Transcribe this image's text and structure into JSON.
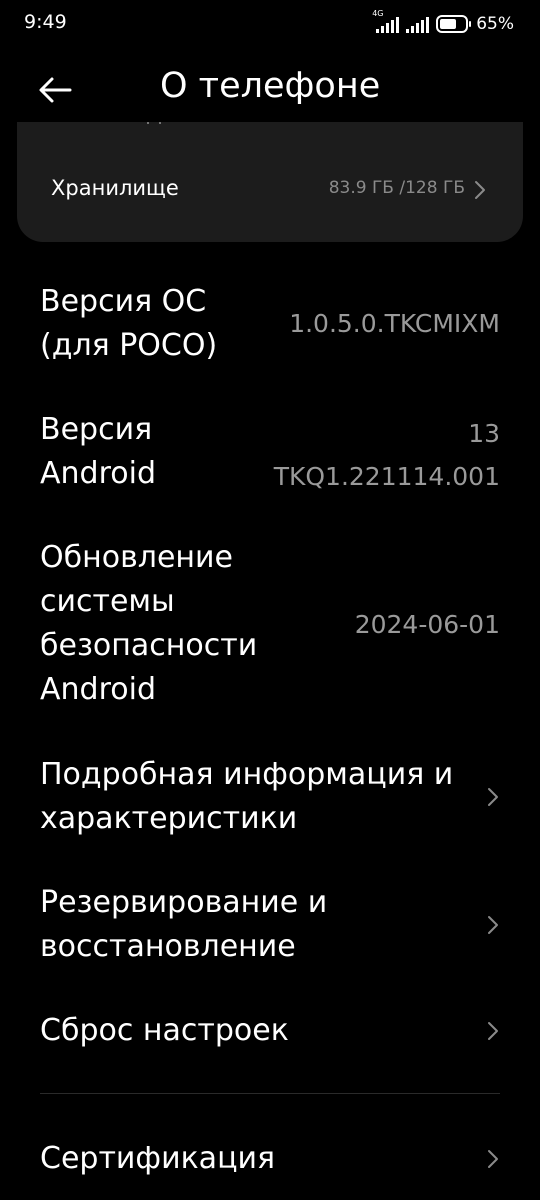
{
  "status_bar": {
    "time": "9:49",
    "network": "4G",
    "battery_percent": "65%",
    "battery_level": 0.65
  },
  "header": {
    "title": "О телефоне"
  },
  "storage": {
    "label": "Хранилище",
    "value": "83.9 ГБ /128 ГБ"
  },
  "rows": [
    {
      "label": "Версия ОС\n(для POCO)",
      "value": "1.0.5.0.TKCMIXM"
    },
    {
      "label": "Версия\nAndroid",
      "value": "13\nTKQ1.221114.001"
    },
    {
      "label": "Обновление\nсистемы\nбезопасности\nAndroid",
      "value": "2024-06-01"
    },
    {
      "label": "Подробная информация и\nхарактеристики"
    },
    {
      "label": "Резервирование и\nвосстановление"
    },
    {
      "label": "Сброс настроек"
    },
    {
      "label": "Сертификация"
    }
  ],
  "colors": {
    "background": "#000000",
    "card": "#1c1c1c",
    "secondary_text": "#9a9a9a"
  }
}
